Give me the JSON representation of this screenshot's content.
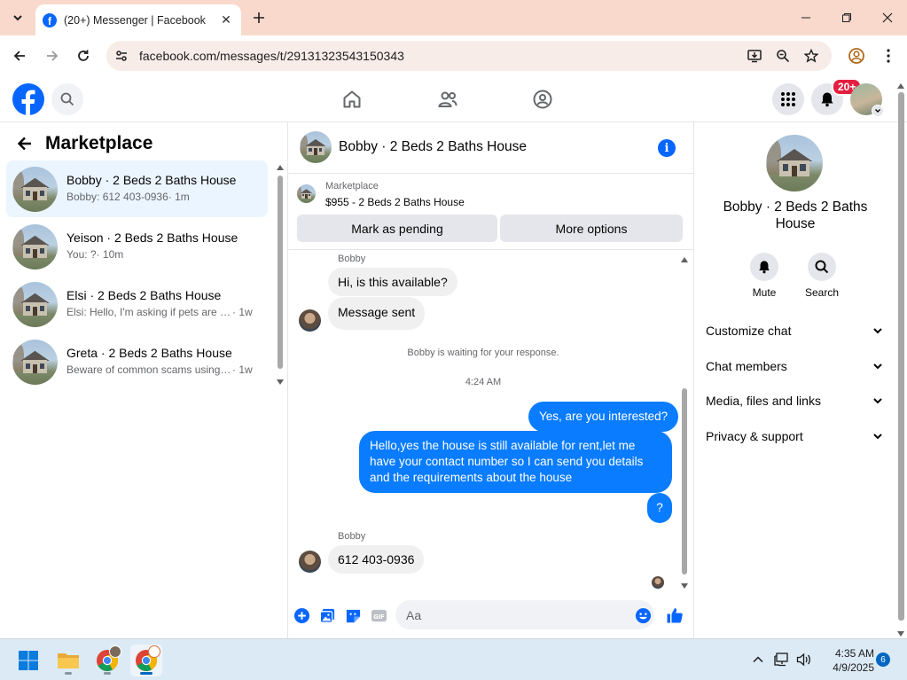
{
  "browser": {
    "tab_title": "(20+) Messenger | Facebook",
    "url": "facebook.com/messages/t/29131323543150343"
  },
  "fb_header": {
    "notification_badge": "20+"
  },
  "left_pane": {
    "title": "Marketplace",
    "conversations": [
      {
        "name": "Bobby · 2 Beds 2 Baths House",
        "preview": "Bobby: 612 403-0936",
        "time": " · 1m"
      },
      {
        "name": "Yeison · 2 Beds 2 Baths House",
        "preview": "You: ?",
        "time": " · 10m"
      },
      {
        "name": "Elsi · 2 Beds 2 Baths House",
        "preview": "Elsi: Hello, I'm asking if pets are ac...",
        "time": " · 1w"
      },
      {
        "name": "Greta · 2 Beds 2 Baths House",
        "preview": "Beware of common scams using p...",
        "time": " · 1w"
      }
    ]
  },
  "chat": {
    "title": "Bobby · 2 Beds 2 Baths House",
    "marketplace_label": "Marketplace",
    "listing": "$955 - 2 Beds 2 Baths House",
    "mark_pending": "Mark as pending",
    "more_options": "More options",
    "sender_name": "Bobby",
    "msg_in_1": "Hi, is this available?",
    "msg_in_2": "Message sent",
    "waiting_note": "Bobby is waiting for your response.",
    "timestamp": "4:24 AM",
    "msg_out_1": "Yes, are you interested?",
    "msg_out_2": "Hello,yes the house is still available for rent,let me have your contact number so I can send you details and the requirements about the house",
    "msg_out_3": "?",
    "msg_in_3": "612 403-0936",
    "composer_placeholder": "Aa"
  },
  "right_pane": {
    "title": "Bobby · 2 Beds 2 Baths House",
    "mute_label": "Mute",
    "search_label": "Search",
    "sections": [
      "Customize chat",
      "Chat members",
      "Media, files and links",
      "Privacy & support"
    ]
  },
  "taskbar": {
    "time": "4:35 AM",
    "date": "4/9/2025",
    "notification_count": "6"
  },
  "colors": {
    "fb_blue": "#0866ff",
    "bubble_out": "#0a7cff",
    "tab_strip": "#f9d9cc",
    "badge_red": "#e41e3f"
  }
}
